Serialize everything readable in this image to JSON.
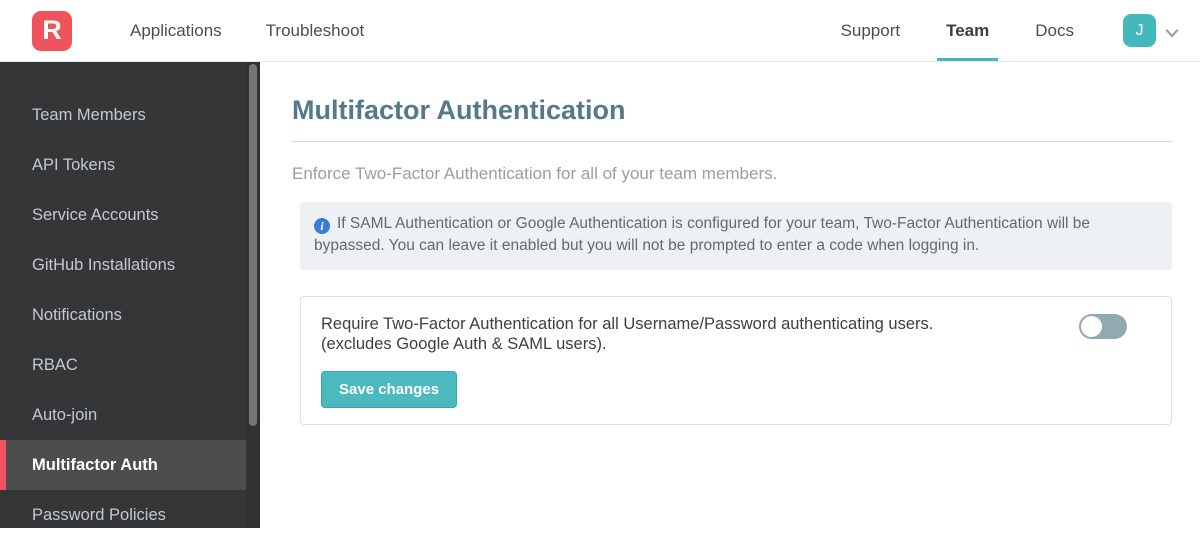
{
  "header": {
    "logo_letter": "R",
    "nav_left": [
      {
        "label": "Applications"
      },
      {
        "label": "Troubleshoot"
      }
    ],
    "nav_right": [
      {
        "label": "Support",
        "active": false
      },
      {
        "label": "Team",
        "active": true
      },
      {
        "label": "Docs",
        "active": false
      }
    ],
    "avatar_initial": "J"
  },
  "sidebar": {
    "items": [
      {
        "label": "Team Members",
        "active": false
      },
      {
        "label": "API Tokens",
        "active": false
      },
      {
        "label": "Service Accounts",
        "active": false
      },
      {
        "label": "GitHub Installations",
        "active": false
      },
      {
        "label": "Notifications",
        "active": false
      },
      {
        "label": "RBAC",
        "active": false
      },
      {
        "label": "Auto-join",
        "active": false
      },
      {
        "label": "Multifactor Auth",
        "active": true
      },
      {
        "label": "Password Policies",
        "active": false
      }
    ]
  },
  "main": {
    "title": "Multifactor Authentication",
    "subtitle": "Enforce Two-Factor Authentication for all of your team members.",
    "info_icon_glyph": "i",
    "info_note": "If SAML Authentication or Google Authentication is configured for your team, Two-Factor Authentication will be bypassed. You can leave it enabled but you will not be prompted to enter a code when logging in.",
    "setting": {
      "label_line1": "Require Two-Factor Authentication for all Username/Password authenticating users.",
      "label_line2": "(excludes Google Auth & SAML users).",
      "toggle_state": "off",
      "save_button_label": "Save changes"
    }
  },
  "colors": {
    "brand_red": "#f1535c",
    "accent_teal": "#45b8bd",
    "title_slate": "#53798a",
    "sidebar_bg": "#353637",
    "active_item_bg": "#4b4d4e",
    "active_item_accent": "#f0535e",
    "info_box_bg": "#edf1f3",
    "info_icon_blue": "#3a7bd5",
    "toggle_off_gray": "#93a9b1",
    "save_button_teal": "#4bb9be"
  }
}
